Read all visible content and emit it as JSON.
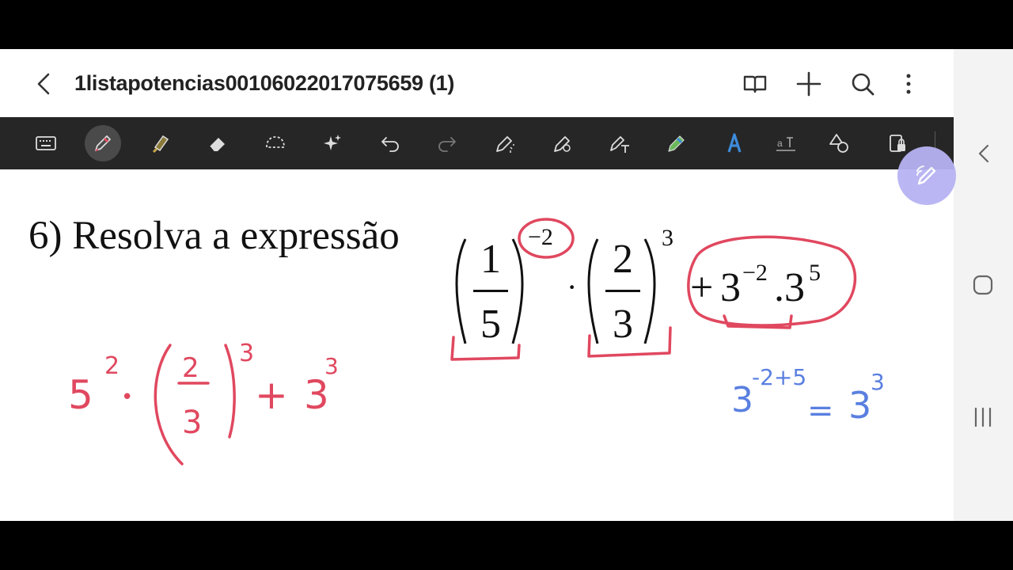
{
  "document": {
    "title": "1listapotencias00106022017075659 (1)"
  },
  "toolbar": {
    "tools": [
      "keyboard-icon",
      "pen-icon",
      "highlighter-icon",
      "eraser-icon",
      "lasso-icon",
      "ai-sparkle-icon",
      "undo-icon",
      "redo-icon",
      "pen-sparkle-icon",
      "pen-settings-icon",
      "text-pen-icon",
      "pencil-icon",
      "text-style-icon",
      "text-spacing-icon",
      "shapes-icon",
      "read-only-icon"
    ],
    "active_tool": "pen-icon"
  },
  "page": {
    "problem_label": "6) Resolva a expressão",
    "formula": {
      "frac1_num": "1",
      "frac1_den": "5",
      "exp1": "−2",
      "dot": "·",
      "frac2_num": "2",
      "frac2_den": "3",
      "exp2": "3",
      "plus": "+",
      "base3": "3",
      "exp3": "−2",
      "mid": ".3",
      "exp4": "5"
    },
    "handwriting": {
      "red_line": {
        "base": "5",
        "exp": "2",
        "dot": "•",
        "num": "2",
        "den": "3",
        "exp2": "3",
        "plus": "+",
        "base2": "3",
        "exp3": "3"
      },
      "blue_line": {
        "base": "3",
        "exp": "-2+5",
        "eq": "=",
        "base2": "3",
        "exp2": "3"
      }
    }
  },
  "colors": {
    "red_ink": "#e0485f",
    "blue_ink": "#5a7fe0",
    "fab": "#b7b3f3",
    "toolbar_bg": "#262626"
  }
}
